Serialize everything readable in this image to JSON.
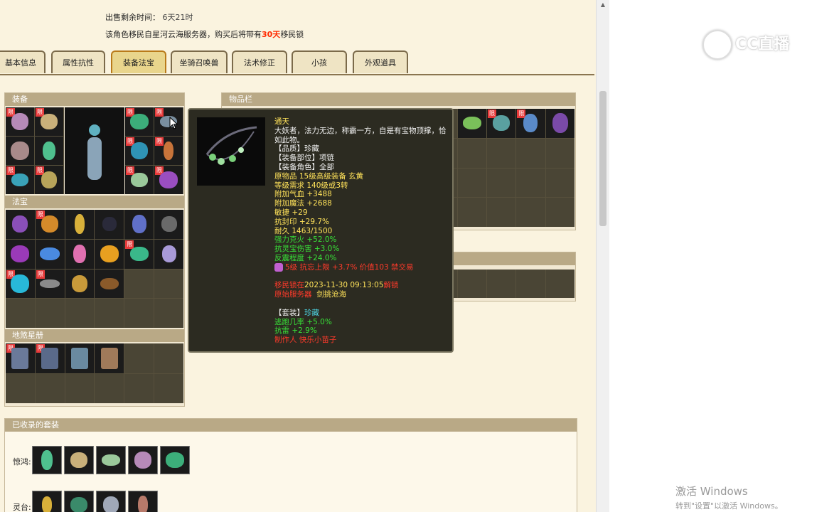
{
  "header": {
    "sale_remaining_label": "出售剩余时间：",
    "sale_remaining_value": "6天21时",
    "migrate_prefix": "该角色移民自星河云海服务器，购买后将带有",
    "migrate_days": "30天",
    "migrate_suffix": "移民锁"
  },
  "tabs": [
    {
      "label": "基本信息"
    },
    {
      "label": "属性抗性"
    },
    {
      "label": "装备法宝"
    },
    {
      "label": "坐骑召唤兽"
    },
    {
      "label": "法术修正"
    },
    {
      "label": "小孩"
    },
    {
      "label": "外观道具"
    }
  ],
  "panels": {
    "equipment_title": "装备",
    "treasure_title": "法宝",
    "star_book_title": "地煞星册",
    "inventory_title": "物品栏",
    "collected_sets_title": "已收录的套装"
  },
  "badge_text": "限",
  "tooltip": {
    "name": "通天",
    "desc": "大妖者，法力无边，称霸一方，自是有宝物顶撑，恰如此物。",
    "quality": "【品质】珍藏",
    "slot": "【装备部位】项链",
    "role": "【装备角色】全部",
    "orig": "原物品 15级高级装备 玄黄",
    "level_req": "等级需求 140级或3转",
    "hp": "附加气血 +3488",
    "mp": "附加魔法 +2688",
    "agi": "敏捷 +29",
    "seal": "抗封印 +29.7%",
    "durability": "耐久 1463/1500",
    "fire": "强力克火 +52.0%",
    "treasure_dmg": "抗灵宝伤害 +3.0%",
    "counter": "反震程度 +24.0%",
    "gem_line": "5级 抗忘上限 +3.7% 价值103 禁交易",
    "lock_prefix": "移民锁在",
    "lock_time": "2023-11-30 09:13:05",
    "lock_suffix": "解锁",
    "origin_prefix": "原始服务器",
    "origin_server": "剑挑沧海",
    "set_label": "【套装】",
    "set_name": "珍藏",
    "set_escape": "逃跑几率 +5.0%",
    "set_thunder": "抗雷 +2.9%",
    "maker": "制作人 快乐小苗子"
  },
  "collected_sets": [
    {
      "label": "惊鸿:"
    },
    {
      "label": "灵台:"
    }
  ],
  "watermark": {
    "text": "CC直播"
  },
  "windows_notice": {
    "line1": "激活 Windows",
    "line2": "转到\"设置\"以激活 Windows。"
  }
}
